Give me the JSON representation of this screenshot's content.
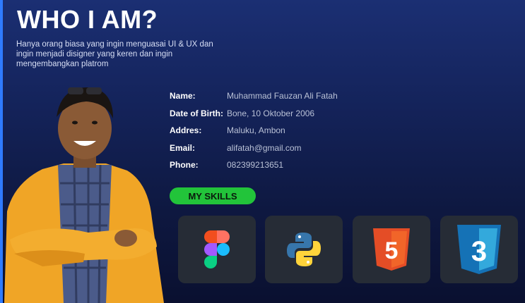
{
  "header": {
    "title": "WHO I AM?",
    "description": "Hanya orang biasa yang ingin menguasai UI & UX dan ingin menjadi disigner yang keren dan ingin mengembangkan platrom"
  },
  "profile": {
    "rows": [
      {
        "label": "Name:",
        "value": "Muhammad Fauzan Ali Fatah"
      },
      {
        "label": "Date of Birth:",
        "value": "Bone, 10 Oktober 2006"
      },
      {
        "label": "Addres:",
        "value": "Maluku, Ambon"
      },
      {
        "label": "Email:",
        "value": "alifatah@gmail.com"
      },
      {
        "label": "Phone:",
        "value": "082399213651"
      }
    ]
  },
  "skills": {
    "label": "MY SKILLS",
    "items": [
      {
        "icon": "figma-icon"
      },
      {
        "icon": "python-icon"
      },
      {
        "icon": "html5-icon",
        "glyph": "5"
      },
      {
        "icon": "css3-icon",
        "glyph": "3"
      }
    ]
  },
  "colors": {
    "accent_bar": "#2f7bff",
    "skills_badge": "#22c43a",
    "card_bg": "#262c36",
    "html5": "#e44d26",
    "css3": "#1572b6"
  }
}
